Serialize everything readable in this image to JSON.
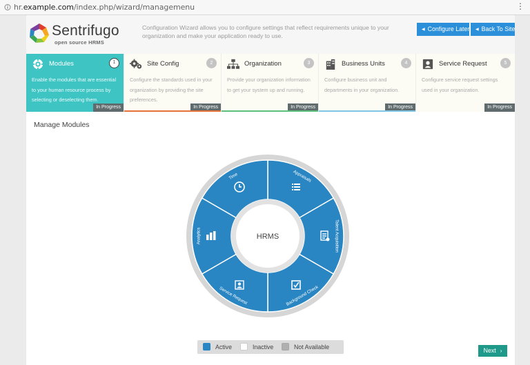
{
  "browser": {
    "url_prefix": "hr.",
    "url_domain": "example.com",
    "url_path": "/index.php/wizard/managemenu",
    "menu_glyph": "⋮"
  },
  "header": {
    "logo_name": "Sentrifugo",
    "logo_tagline": "open source HRMS",
    "intro": "Configuration Wizard allows you to configure settings that reflect requirements unique to your organization and make your application ready to use.",
    "configure_later": "Configure Later",
    "back_to_site": "Back To Site",
    "button_arrow": "◀"
  },
  "steps": [
    {
      "title": "Modules",
      "number": "1",
      "desc": "Enable the modules that are essential to your human resource process by selecting or deselecting them.",
      "status": "In Progress",
      "icon": "gear-icon",
      "line_color": "#3fc4c4"
    },
    {
      "title": "Site Config",
      "number": "2",
      "desc": "Configure the standards used in your organization by providing the site preferences.",
      "status": "In Progress",
      "icon": "gears-icon",
      "line_color": "#e8733a"
    },
    {
      "title": "Organization",
      "number": "3",
      "desc": "Provide your organization information to get your system up and running.",
      "status": "In Progress",
      "icon": "org-chart-icon",
      "line_color": "#5bbf7a"
    },
    {
      "title": "Business Units",
      "number": "4",
      "desc": "Configure business unit and departments in your organization.",
      "status": "In Progress",
      "icon": "building-icon",
      "line_color": "#7fc6e6"
    },
    {
      "title": "Service Request",
      "number": "5",
      "desc": "Configure service request settings used in your organization.",
      "status": "In Progress",
      "icon": "service-desk-icon",
      "line_color": "#e8e0b0"
    }
  ],
  "main": {
    "title": "Manage Modules",
    "wheel_center": "HRMS",
    "wheel_color": "#2a86c3",
    "segments": [
      {
        "label": "Appraisals",
        "icon": "list-icon"
      },
      {
        "label": "Talent Acquisition",
        "icon": "resume-icon"
      },
      {
        "label": "Background Check",
        "icon": "checkbox-icon"
      },
      {
        "label": "Service Request",
        "icon": "id-card-icon"
      },
      {
        "label": "Analytics",
        "icon": "bar-chart-icon"
      },
      {
        "label": "Time",
        "icon": "clock-icon"
      }
    ],
    "legend": [
      {
        "label": "Active",
        "color": "#2a86c3"
      },
      {
        "label": "Inactive",
        "color": "#ffffff"
      },
      {
        "label": "Not Available",
        "color": "#b0b0b0"
      }
    ],
    "next": "Next",
    "next_chevron": "›"
  }
}
